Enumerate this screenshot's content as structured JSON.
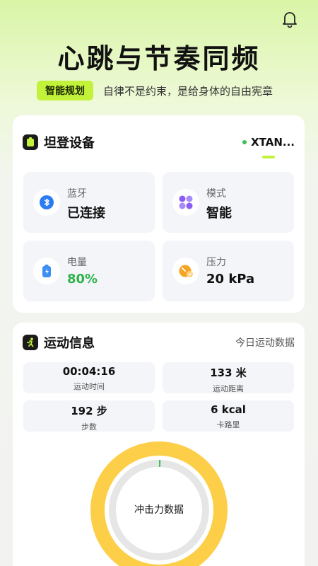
{
  "header": {
    "title": "心跳与节奏同频",
    "tag": "智能规划",
    "slogan": "自律不是约束，是给身体的自由宪章"
  },
  "device_card": {
    "title": "坦登设备",
    "device_name": "XTAN...",
    "tiles": [
      {
        "label": "蓝牙",
        "value": "已连接",
        "icon": "bluetooth-icon"
      },
      {
        "label": "模式",
        "value": "智能",
        "icon": "grid-dots-icon"
      },
      {
        "label": "电量",
        "value": "80%",
        "icon": "battery-icon"
      },
      {
        "label": "压力",
        "value": "20 kPa",
        "icon": "pressure-gauge-icon"
      }
    ]
  },
  "sport_card": {
    "title": "运动信息",
    "right_label": "今日运动数据",
    "stats": [
      {
        "value": "00:04:16",
        "label": "运动时间"
      },
      {
        "value": "133 米",
        "label": "运动距离"
      },
      {
        "value": "192 步",
        "label": "步数"
      },
      {
        "value": "6 kcal",
        "label": "卡路里"
      }
    ],
    "ring_label": "冲击力数据",
    "ring_progress": 0.005
  },
  "colors": {
    "accent_lime": "#c2f23a",
    "ring_yellow": "#fdcf48",
    "ok_green": "#2db34a",
    "bluetooth_blue": "#2b7bf3",
    "mode_purple": "#8b5cf6",
    "battery_blue": "#3b8ff3",
    "pressure_orange": "#f5a524"
  }
}
